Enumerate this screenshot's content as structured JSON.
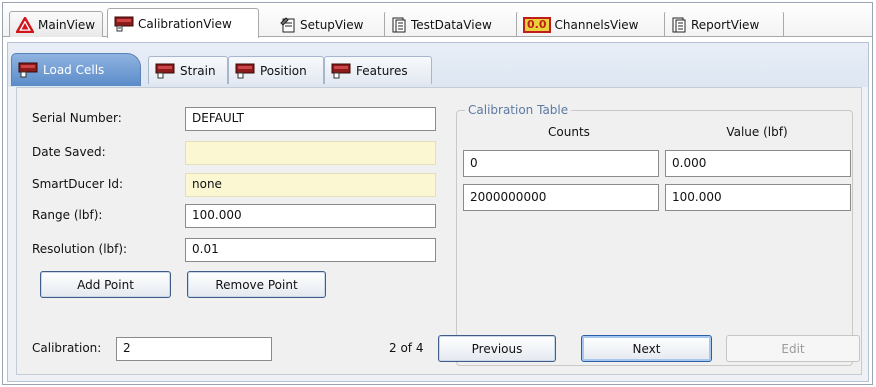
{
  "top_tabs": [
    {
      "label": "MainView",
      "icon": "warning-icon"
    },
    {
      "label": "CalibrationView",
      "icon": "calibration-icon"
    },
    {
      "label": "SetupView",
      "icon": "setup-icon"
    },
    {
      "label": "TestDataView",
      "icon": "document-icon"
    },
    {
      "label": "ChannelsView",
      "icon": "channels-icon",
      "icon_text": "0.0"
    },
    {
      "label": "ReportView",
      "icon": "document-icon"
    }
  ],
  "sub_tabs": [
    {
      "label": "Load Cells"
    },
    {
      "label": "Strain"
    },
    {
      "label": "Position"
    },
    {
      "label": "Features"
    }
  ],
  "form": {
    "serial_number_label": "Serial Number:",
    "serial_number_value": "DEFAULT",
    "date_saved_label": "Date Saved:",
    "date_saved_value": "",
    "smartducer_label": "SmartDucer Id:",
    "smartducer_value": "none",
    "range_label": "Range (lbf):",
    "range_value": "100.000",
    "resolution_label": "Resolution (lbf):",
    "resolution_value": "0.01",
    "add_point_label": "Add Point",
    "remove_point_label": "Remove Point"
  },
  "calibration_table": {
    "title": "Calibration Table",
    "columns": [
      "Counts",
      "Value (lbf)"
    ],
    "rows": [
      [
        "0",
        "0.000"
      ],
      [
        "2000000000",
        "100.000"
      ]
    ]
  },
  "footer": {
    "calibration_label": "Calibration:",
    "calibration_value": "2",
    "page_indicator": "2 of 4",
    "previous_label": "Previous",
    "next_label": "Next",
    "edit_label": "Edit"
  },
  "colors": {
    "active_subtab": "#5b8cc9",
    "readonly_field": "#fbf7d3",
    "group_title": "#5c7aa2"
  }
}
